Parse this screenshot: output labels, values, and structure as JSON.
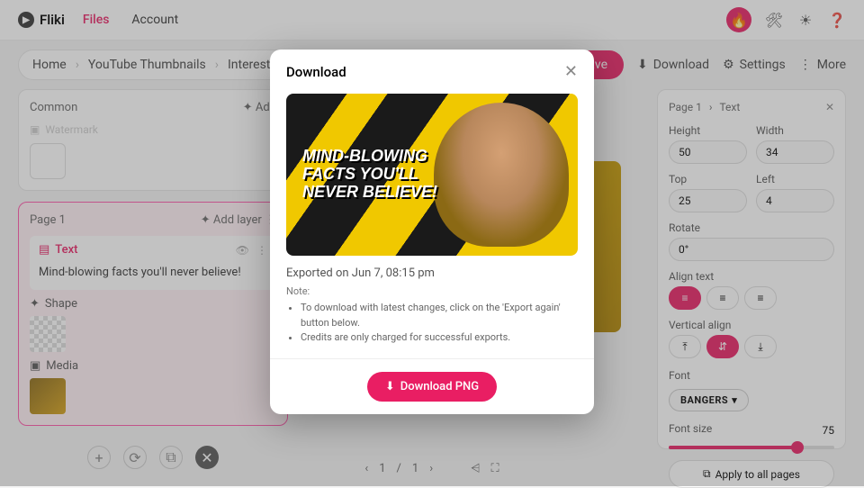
{
  "brand": "Fliki",
  "topnav": {
    "files": "Files",
    "account": "Account"
  },
  "breadcrumb": {
    "home": "Home",
    "folder": "YouTube Thumbnails",
    "file": "Interesting Facts"
  },
  "toolbar": {
    "save": "Save",
    "download": "Download",
    "settings": "Settings",
    "more": "More"
  },
  "left": {
    "common": "Common",
    "add": "Add",
    "watermark": "Watermark",
    "page": "Page 1",
    "addlayer": "Add layer",
    "text": "Text",
    "textval": "Mind-blowing facts you'll never believe!",
    "shape": "Shape",
    "media": "Media"
  },
  "right": {
    "page": "Page 1",
    "text": "Text",
    "height": "Height",
    "heightv": "50",
    "width": "Width",
    "widthv": "34",
    "top": "Top",
    "topv": "25",
    "left": "Left",
    "leftv": "4",
    "rotate": "Rotate",
    "rotatev": "0°",
    "aligntext": "Align text",
    "valign": "Vertical align",
    "font": "Font",
    "fontv": "BANGERS",
    "fontsize": "Font size",
    "fontsizev": "75",
    "apply": "Apply to all pages"
  },
  "pager": {
    "current": "1",
    "total": "1"
  },
  "modal": {
    "title": "Download",
    "previewtext": "Mind-blowing facts you'll never believe!",
    "exportedon": "Exported on Jun 7, 08:15 pm",
    "note": "Note:",
    "note1": "To download with latest changes, click on the 'Export again' button below.",
    "note2": "Credits are only charged for successful exports.",
    "dlbtn": "Download PNG"
  }
}
